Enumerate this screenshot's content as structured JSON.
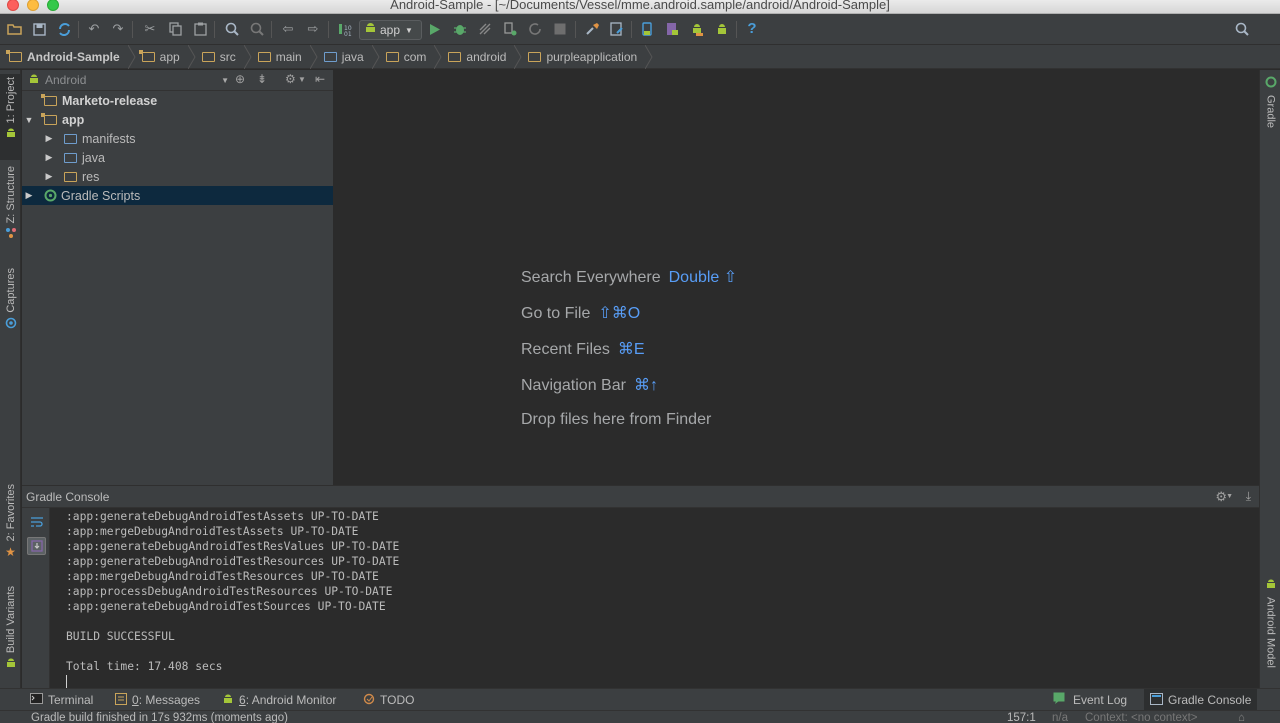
{
  "window": {
    "title": "Android-Sample - [~/Documents/Vessel/mme.android.sample/android/Android-Sample]"
  },
  "toolbar": {
    "run_config": "app",
    "icons": [
      "open-icon",
      "save-icon",
      "sync-icon",
      "undo-icon",
      "redo-icon",
      "cut-icon",
      "copy-icon",
      "paste-icon",
      "find-icon",
      "replace-icon",
      "back-icon",
      "forward-icon",
      "make-icon",
      "run-icon",
      "debug-icon",
      "attach-icon",
      "coverage-icon",
      "rerun-icon",
      "stop-icon",
      "project-structure-icon",
      "gradle-sync-icon",
      "avd-manager-icon",
      "sdk-manager-icon",
      "android-device-monitor-icon",
      "help-icon",
      "search-everywhere-icon"
    ]
  },
  "breadcrumbs": [
    "Android-Sample",
    "app",
    "src",
    "main",
    "java",
    "com",
    "android",
    "purpleapplication"
  ],
  "left_stripe": {
    "project": "1: Project",
    "structure": "Z: Structure",
    "captures": "Captures",
    "favorites": "2: Favorites",
    "build_variants": "Build Variants"
  },
  "right_stripe": {
    "gradle": "Gradle",
    "android_model": "Android Model"
  },
  "project_panel": {
    "view": "Android",
    "tree": [
      {
        "label": "Marketo-release",
        "bold": true
      },
      {
        "label": "app",
        "bold": true
      },
      {
        "label": "manifests"
      },
      {
        "label": "java"
      },
      {
        "label": "res"
      },
      {
        "label": "Gradle Scripts",
        "selected": true
      }
    ]
  },
  "editor": {
    "hints": [
      {
        "label": "Search Everywhere",
        "shortcut": "Double ⇧"
      },
      {
        "label": "Go to File",
        "shortcut": "⇧⌘O"
      },
      {
        "label": "Recent Files",
        "shortcut": "⌘E"
      },
      {
        "label": "Navigation Bar",
        "shortcut": "⌘↑"
      },
      {
        "label": "Drop files here from Finder",
        "shortcut": ""
      }
    ]
  },
  "console": {
    "title": "Gradle Console",
    "lines": [
      ":app:generateDebugAndroidTestAssets UP-TO-DATE",
      ":app:mergeDebugAndroidTestAssets UP-TO-DATE",
      ":app:generateDebugAndroidTestResValues UP-TO-DATE",
      ":app:generateDebugAndroidTestResources UP-TO-DATE",
      ":app:mergeDebugAndroidTestResources UP-TO-DATE",
      ":app:processDebugAndroidTestResources UP-TO-DATE",
      ":app:generateDebugAndroidTestSources UP-TO-DATE",
      "",
      "BUILD SUCCESSFUL",
      "",
      "Total time: 17.408 secs"
    ]
  },
  "bottom_bar": {
    "terminal": "Terminal",
    "messages_num": "0",
    "messages": ": Messages",
    "android_monitor_num": "6",
    "android_monitor": ": Android Monitor",
    "todo": "TODO",
    "event_log": "Event Log",
    "gradle_console": "Gradle Console"
  },
  "status": {
    "message": "Gradle build finished in 17s 932ms (moments ago)",
    "position": "157:1",
    "na": "n/a",
    "context": "Context: <no context>"
  }
}
